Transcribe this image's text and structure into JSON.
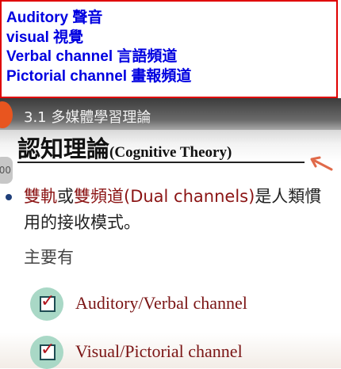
{
  "glossary": {
    "lines": [
      "Auditory 聲音",
      "visual 視覺",
      "Verbal channel 言語頻道",
      "Pictorial channel 畫報頻道"
    ]
  },
  "video_header": {
    "section_title": "3.1 多媒體學習理論"
  },
  "side_chip": "00",
  "slide": {
    "title_zh": "認知理論",
    "title_en": "(Cognitive Theory)",
    "bullet": {
      "part1": "雙軌",
      "part2": "或",
      "part3": "雙頻道",
      "part4": "(",
      "part5": "Dual channels",
      "part6": ")",
      "part7": "是人類慣用的接收模式。"
    },
    "sub_label": "主要有",
    "check_items": [
      "Auditory/Verbal channel",
      "Visual/Pictorial channel"
    ]
  },
  "colors": {
    "glossary_text": "#0000e0",
    "glossary_border": "#e00000",
    "accent_dark_red": "#8b1414",
    "check_circle": "#a9d8c6"
  }
}
